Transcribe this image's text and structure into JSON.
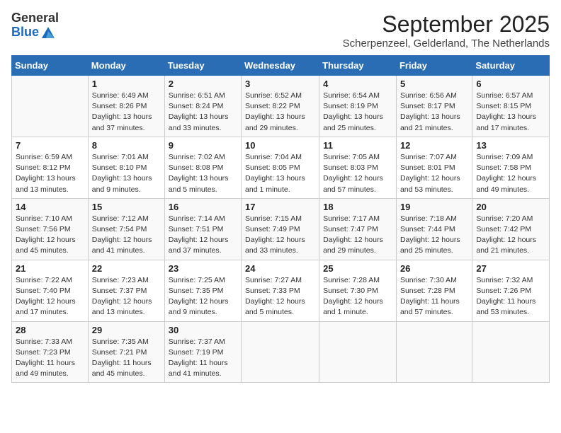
{
  "header": {
    "logo_general": "General",
    "logo_blue": "Blue",
    "month": "September 2025",
    "location": "Scherpenzeel, Gelderland, The Netherlands"
  },
  "days_of_week": [
    "Sunday",
    "Monday",
    "Tuesday",
    "Wednesday",
    "Thursday",
    "Friday",
    "Saturday"
  ],
  "weeks": [
    [
      {
        "day": "",
        "info": ""
      },
      {
        "day": "1",
        "info": "Sunrise: 6:49 AM\nSunset: 8:26 PM\nDaylight: 13 hours\nand 37 minutes."
      },
      {
        "day": "2",
        "info": "Sunrise: 6:51 AM\nSunset: 8:24 PM\nDaylight: 13 hours\nand 33 minutes."
      },
      {
        "day": "3",
        "info": "Sunrise: 6:52 AM\nSunset: 8:22 PM\nDaylight: 13 hours\nand 29 minutes."
      },
      {
        "day": "4",
        "info": "Sunrise: 6:54 AM\nSunset: 8:19 PM\nDaylight: 13 hours\nand 25 minutes."
      },
      {
        "day": "5",
        "info": "Sunrise: 6:56 AM\nSunset: 8:17 PM\nDaylight: 13 hours\nand 21 minutes."
      },
      {
        "day": "6",
        "info": "Sunrise: 6:57 AM\nSunset: 8:15 PM\nDaylight: 13 hours\nand 17 minutes."
      }
    ],
    [
      {
        "day": "7",
        "info": "Sunrise: 6:59 AM\nSunset: 8:12 PM\nDaylight: 13 hours\nand 13 minutes."
      },
      {
        "day": "8",
        "info": "Sunrise: 7:01 AM\nSunset: 8:10 PM\nDaylight: 13 hours\nand 9 minutes."
      },
      {
        "day": "9",
        "info": "Sunrise: 7:02 AM\nSunset: 8:08 PM\nDaylight: 13 hours\nand 5 minutes."
      },
      {
        "day": "10",
        "info": "Sunrise: 7:04 AM\nSunset: 8:05 PM\nDaylight: 13 hours\nand 1 minute."
      },
      {
        "day": "11",
        "info": "Sunrise: 7:05 AM\nSunset: 8:03 PM\nDaylight: 12 hours\nand 57 minutes."
      },
      {
        "day": "12",
        "info": "Sunrise: 7:07 AM\nSunset: 8:01 PM\nDaylight: 12 hours\nand 53 minutes."
      },
      {
        "day": "13",
        "info": "Sunrise: 7:09 AM\nSunset: 7:58 PM\nDaylight: 12 hours\nand 49 minutes."
      }
    ],
    [
      {
        "day": "14",
        "info": "Sunrise: 7:10 AM\nSunset: 7:56 PM\nDaylight: 12 hours\nand 45 minutes."
      },
      {
        "day": "15",
        "info": "Sunrise: 7:12 AM\nSunset: 7:54 PM\nDaylight: 12 hours\nand 41 minutes."
      },
      {
        "day": "16",
        "info": "Sunrise: 7:14 AM\nSunset: 7:51 PM\nDaylight: 12 hours\nand 37 minutes."
      },
      {
        "day": "17",
        "info": "Sunrise: 7:15 AM\nSunset: 7:49 PM\nDaylight: 12 hours\nand 33 minutes."
      },
      {
        "day": "18",
        "info": "Sunrise: 7:17 AM\nSunset: 7:47 PM\nDaylight: 12 hours\nand 29 minutes."
      },
      {
        "day": "19",
        "info": "Sunrise: 7:18 AM\nSunset: 7:44 PM\nDaylight: 12 hours\nand 25 minutes."
      },
      {
        "day": "20",
        "info": "Sunrise: 7:20 AM\nSunset: 7:42 PM\nDaylight: 12 hours\nand 21 minutes."
      }
    ],
    [
      {
        "day": "21",
        "info": "Sunrise: 7:22 AM\nSunset: 7:40 PM\nDaylight: 12 hours\nand 17 minutes."
      },
      {
        "day": "22",
        "info": "Sunrise: 7:23 AM\nSunset: 7:37 PM\nDaylight: 12 hours\nand 13 minutes."
      },
      {
        "day": "23",
        "info": "Sunrise: 7:25 AM\nSunset: 7:35 PM\nDaylight: 12 hours\nand 9 minutes."
      },
      {
        "day": "24",
        "info": "Sunrise: 7:27 AM\nSunset: 7:33 PM\nDaylight: 12 hours\nand 5 minutes."
      },
      {
        "day": "25",
        "info": "Sunrise: 7:28 AM\nSunset: 7:30 PM\nDaylight: 12 hours\nand 1 minute."
      },
      {
        "day": "26",
        "info": "Sunrise: 7:30 AM\nSunset: 7:28 PM\nDaylight: 11 hours\nand 57 minutes."
      },
      {
        "day": "27",
        "info": "Sunrise: 7:32 AM\nSunset: 7:26 PM\nDaylight: 11 hours\nand 53 minutes."
      }
    ],
    [
      {
        "day": "28",
        "info": "Sunrise: 7:33 AM\nSunset: 7:23 PM\nDaylight: 11 hours\nand 49 minutes."
      },
      {
        "day": "29",
        "info": "Sunrise: 7:35 AM\nSunset: 7:21 PM\nDaylight: 11 hours\nand 45 minutes."
      },
      {
        "day": "30",
        "info": "Sunrise: 7:37 AM\nSunset: 7:19 PM\nDaylight: 11 hours\nand 41 minutes."
      },
      {
        "day": "",
        "info": ""
      },
      {
        "day": "",
        "info": ""
      },
      {
        "day": "",
        "info": ""
      },
      {
        "day": "",
        "info": ""
      }
    ]
  ]
}
